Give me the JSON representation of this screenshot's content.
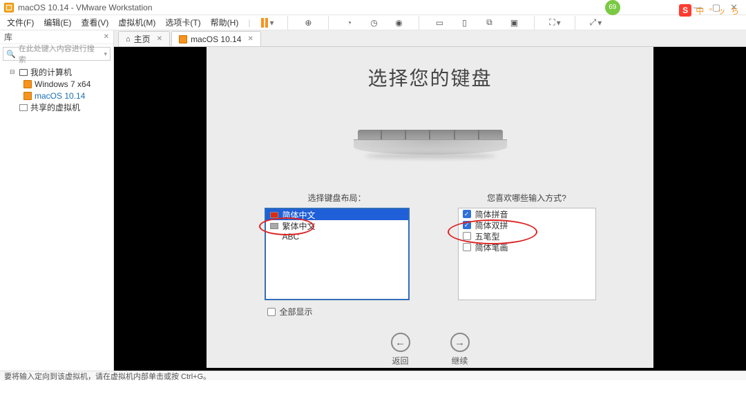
{
  "window": {
    "title": "macOS 10.14 - VMware Workstation",
    "badge": "69"
  },
  "menu": {
    "file": "文件(F)",
    "edit": "编辑(E)",
    "view": "查看(V)",
    "vm": "虚拟机(M)",
    "tabs": "选项卡(T)",
    "help": "帮助(H)"
  },
  "ime": {
    "letter": "S",
    "chars": "中 ° ッ ち"
  },
  "sidebar": {
    "library_label": "库",
    "search_placeholder": "在此处键入内容进行搜索",
    "my_computer": "我的计算机",
    "vm1": "Windows 7 x64",
    "vm2": "macOS 10.14",
    "shared": "共享的虚拟机"
  },
  "tabs": {
    "home": "主页",
    "vm": "macOS 10.14"
  },
  "panel": {
    "title": "选择您的键盘",
    "left_label": "选择键盘布局：",
    "right_label": "您喜欢哪些输入方式?",
    "layouts": {
      "simplified": "简体中文",
      "traditional": "繁体中文",
      "abc": "ABC"
    },
    "inputs": {
      "pinyin": "简体拼音",
      "shuangpin": "简体双拼",
      "wubixing": "五笔型",
      "wubibihua": "简体笔画"
    },
    "show_all": "全部显示",
    "back": "返回",
    "continue": "继续"
  },
  "status": {
    "text": "要将输入定向到该虚拟机，请在虚拟机内部单击或按 Ctrl+G。"
  }
}
